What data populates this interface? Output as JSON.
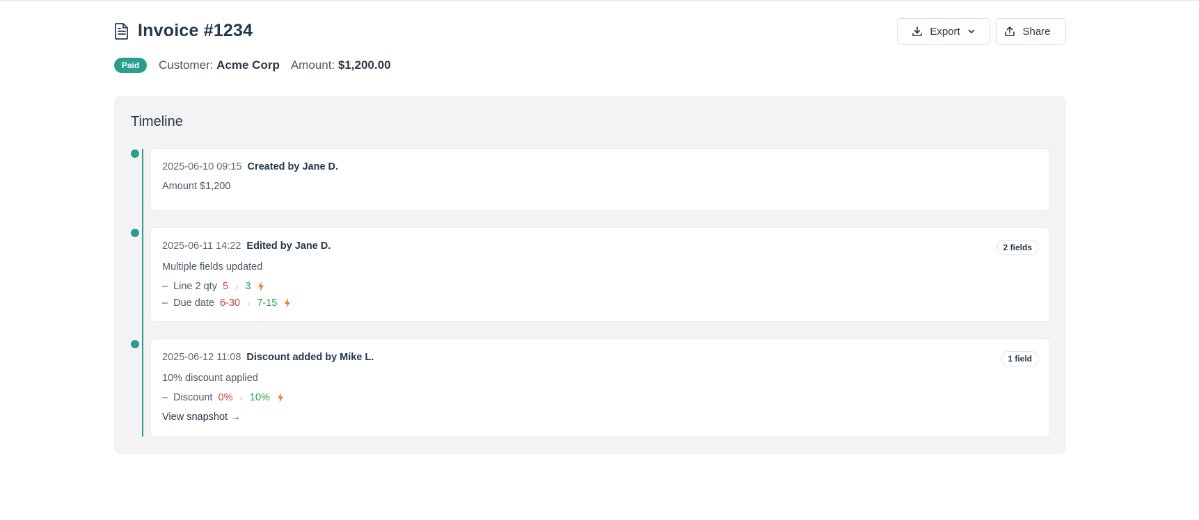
{
  "header": {
    "title": "Invoice #1234",
    "export_label": "Export",
    "share_label": "Share"
  },
  "meta": {
    "status": "Paid",
    "customer_label": "Customer:",
    "customer_value": "Acme Corp",
    "amount_label": "Amount:",
    "amount_value": "$1,200.00"
  },
  "timeline": {
    "title": "Timeline",
    "entries": [
      {
        "timestamp": "2025-06-10 09:15",
        "actor": "Created by Jane D.",
        "description": "Amount $1,200"
      },
      {
        "timestamp": "2025-06-11 14:22",
        "actor": "Edited by Jane D.",
        "description": "Multiple fields updated",
        "badge": "2 fields",
        "changes": [
          {
            "field": "Line 2 qty",
            "old": "5",
            "new": "3"
          },
          {
            "field": "Due date",
            "old": "6-30",
            "new": "7-15"
          }
        ]
      },
      {
        "timestamp": "2025-06-12 11:08",
        "actor": "Discount added by Mike L.",
        "description": "10% discount applied",
        "badge": "1 field",
        "changes": [
          {
            "field": "Discount",
            "old": "0%",
            "new": "10%"
          }
        ],
        "link": "View snapshot →"
      }
    ]
  },
  "colors": {
    "accent": "#2a9d8f",
    "old_value": "#d43b3b",
    "new_value": "#2e9e48",
    "bolt": "#f07a2b"
  },
  "icons": {
    "title": "document-icon",
    "export": "download-icon",
    "export_menu": "chevron-down-icon",
    "share": "share-icon",
    "change": "lightning-bolt-icon"
  }
}
